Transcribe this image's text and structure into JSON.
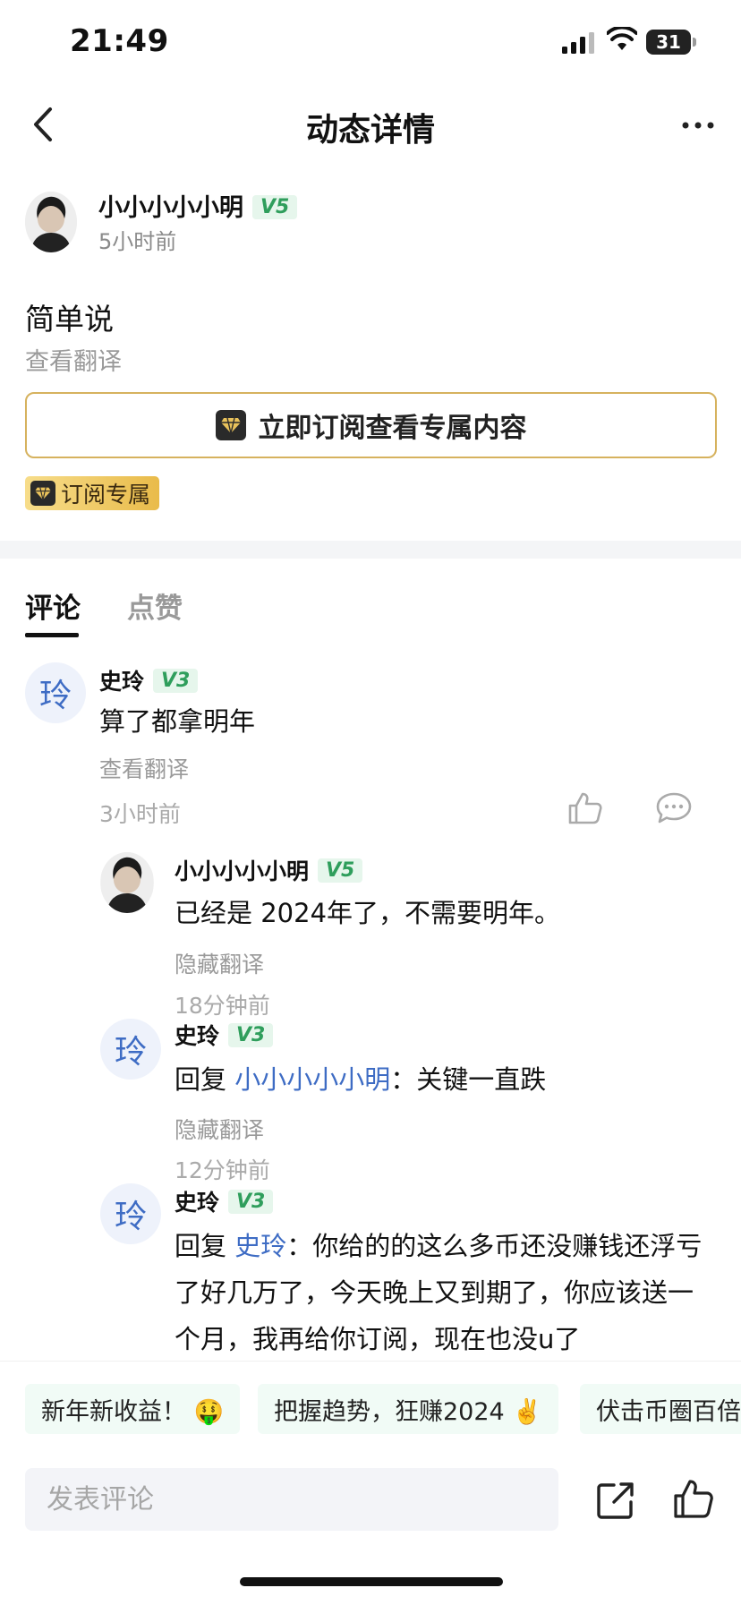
{
  "status_bar": {
    "time": "21:49",
    "battery": "31"
  },
  "nav": {
    "title": "动态详情"
  },
  "post": {
    "username": "小小小小小明",
    "level": "V5",
    "time": "5小时前",
    "content": "简单说",
    "translate_label": "查看翻译",
    "subscribe_button": "立即订阅查看专属内容",
    "subscribe_tag": "订阅专属"
  },
  "tabs": [
    {
      "label": "评论",
      "active": true
    },
    {
      "label": "点赞",
      "active": false
    }
  ],
  "comments": [
    {
      "avatar_text": "玲",
      "username": "史玲",
      "level": "V3",
      "text": "算了都拿明年",
      "translate_label": "查看翻译",
      "time": "3小时前"
    }
  ],
  "replies": [
    {
      "avatar_icon": "user-photo-avatar",
      "username": "小小小小小明",
      "level": "V5",
      "text": "已经是 2024年了，不需要明年。",
      "translate_label": "隐藏翻译",
      "time": "18分钟前"
    },
    {
      "avatar_text": "玲",
      "username": "史玲",
      "level": "V3",
      "reply_prefix": "回复 ",
      "mention": "小小小小小明",
      "text": "：关键一直跌",
      "translate_label": "隐藏翻译",
      "time": "12分钟前"
    },
    {
      "avatar_text": "玲",
      "username": "史玲",
      "level": "V3",
      "reply_prefix": "回复 ",
      "mention": "史玲",
      "text": "：你给的的这么多币还没赚钱还浮亏了好几万了，今天晚上又到期了，你应该送一个月，我再给你订阅，现在也没u了"
    }
  ],
  "topics": [
    "新年新收益！ 🤑",
    "把握趋势，狂赚2024 ✌️",
    "伏击币圈百倍"
  ],
  "comment_input": {
    "placeholder": "发表评论",
    "value": ""
  },
  "colors": {
    "accent_blue": "#3e6cc4",
    "badge_green": "#2f9e5c",
    "gold": "#d6b25e"
  }
}
